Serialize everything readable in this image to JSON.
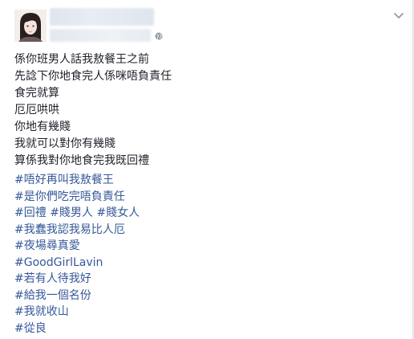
{
  "post": {
    "lines": [
      "係你班男人話我敖餐王之前",
      "先諗下你地食完人係咪唔負責任",
      "食完就算",
      "厄厄哄哄",
      "你地有幾賤",
      "我就可以對你有幾賤",
      "算係我對你地食完我既回禮"
    ],
    "hashtag_lines": [
      [
        "#唔好再叫我敖餐王"
      ],
      [
        "#是你們吃完唔負責任"
      ],
      [
        "#回禮",
        "#賤男人",
        "#賤女人"
      ],
      [
        "#我蠢我認我易比人厄"
      ],
      [
        "#夜場尋真愛"
      ],
      [
        "#GoodGirlLavin"
      ],
      [
        "#若有人待我好"
      ],
      [
        "#給我一個名份"
      ],
      [
        "#我就收山"
      ],
      [
        "#從良"
      ]
    ]
  },
  "icons": {
    "privacy": "globe-icon",
    "options": "chevron-down-icon"
  },
  "colors": {
    "text": "#1d2129",
    "hashtag": "#365899",
    "background": "#e9ebee",
    "card": "#ffffff"
  }
}
